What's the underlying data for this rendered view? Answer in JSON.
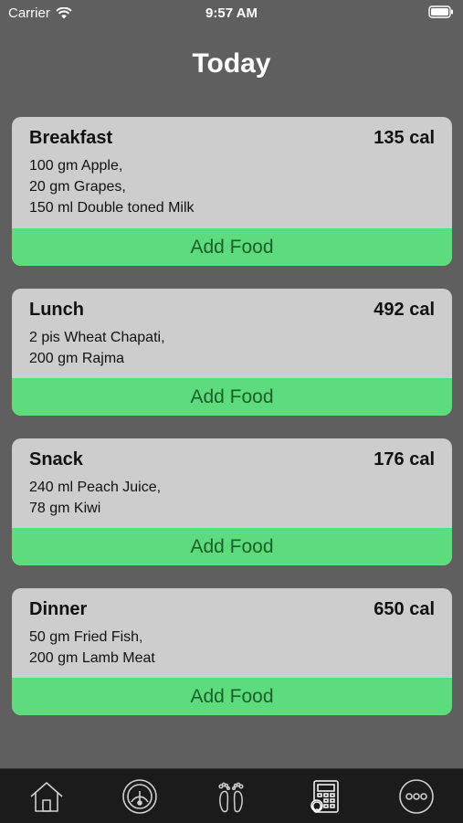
{
  "status": {
    "carrier": "Carrier",
    "time": "9:57 AM"
  },
  "page": {
    "title": "Today"
  },
  "meals": [
    {
      "name": "Breakfast",
      "calories": "135 cal",
      "items": [
        "100 gm Apple,",
        "20 gm Grapes,",
        "150 ml Double toned Milk"
      ],
      "button": "Add Food"
    },
    {
      "name": "Lunch",
      "calories": "492 cal",
      "items": [
        "2 pis Wheat Chapati,",
        "200 gm Rajma"
      ],
      "button": "Add Food"
    },
    {
      "name": "Snack",
      "calories": "176 cal",
      "items": [
        "240 ml Peach Juice,",
        "78 gm Kiwi"
      ],
      "button": "Add Food"
    },
    {
      "name": "Dinner",
      "calories": "650 cal",
      "items": [
        "50 gm Fried Fish,",
        "200 gm Lamb Meat"
      ],
      "button": "Add Food"
    }
  ],
  "tabbar": {
    "tabs": [
      {
        "icon": "home-icon"
      },
      {
        "icon": "gauge-icon"
      },
      {
        "icon": "footprints-icon"
      },
      {
        "icon": "calculator-icon"
      },
      {
        "icon": "more-icon"
      }
    ]
  },
  "colors": {
    "background": "#5f5f5f",
    "card": "#cdcdcd",
    "accent_green": "#5cdc7c",
    "button_text": "#1c5e2c",
    "tabbar": "#1b1b1b"
  }
}
